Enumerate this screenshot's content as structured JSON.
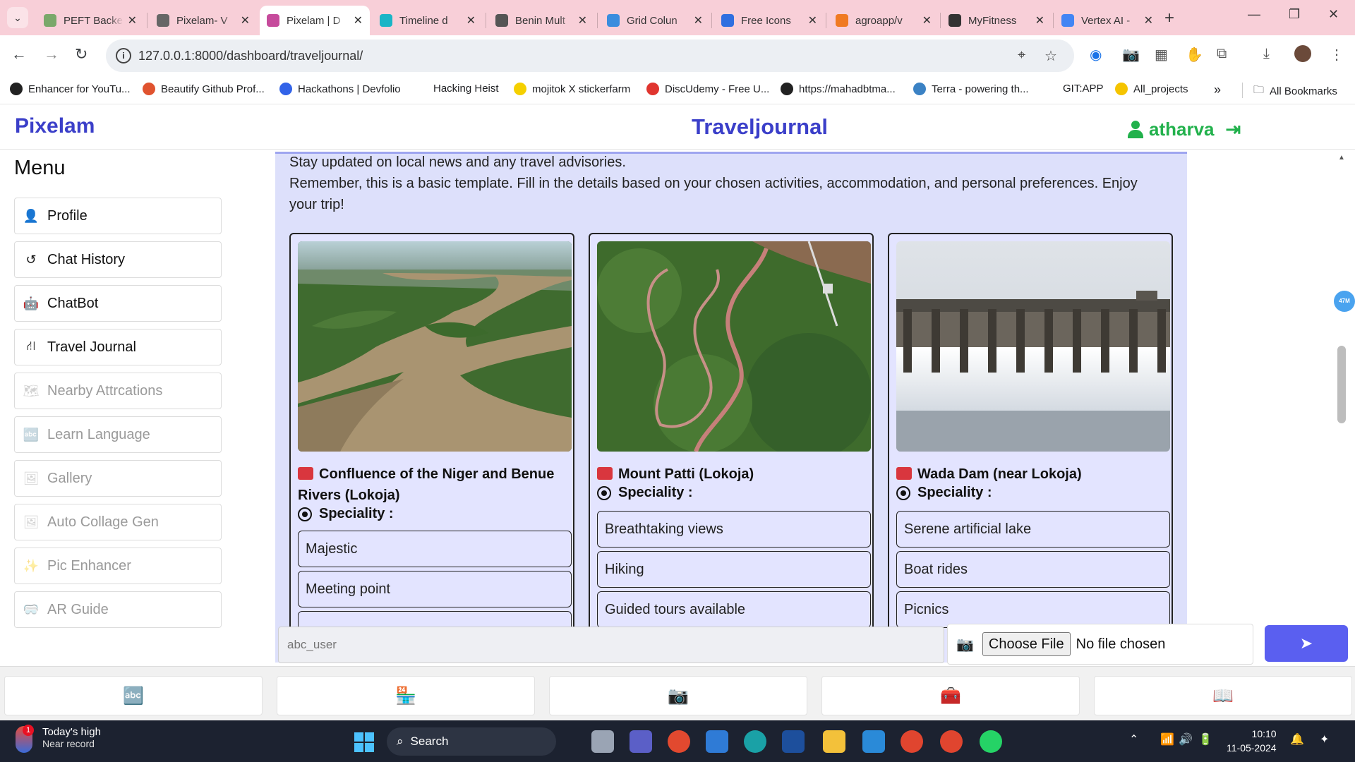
{
  "browser": {
    "tabs": [
      {
        "label": "PEFT Backe",
        "color": "#7aa86a"
      },
      {
        "label": "Pixelam- V",
        "color": "#666666"
      },
      {
        "label": "Pixelam | D",
        "color": "#c64b9c"
      },
      {
        "label": "Timeline d",
        "color": "#19b5c6"
      },
      {
        "label": "Benin Mult",
        "color": "#555555"
      },
      {
        "label": "Grid Colun",
        "color": "#3a8dde"
      },
      {
        "label": "Free Icons",
        "color": "#2f6fe0"
      },
      {
        "label": "agroapp/v",
        "color": "#f07a22"
      },
      {
        "label": "MyFitness",
        "color": "#333333"
      },
      {
        "label": "Vertex AI -",
        "color": "#4285f4"
      }
    ],
    "url": "127.0.0.1:8000/dashboard/traveljournal/",
    "bookmarks": [
      {
        "label": "Enhancer for YouTu...",
        "color": "#222222"
      },
      {
        "label": "Beautify Github Prof...",
        "color": "#e0532f"
      },
      {
        "label": "Hackathons | Devfolio",
        "color": "#3263e8"
      },
      {
        "label": "Hacking Heist",
        "color": ""
      },
      {
        "label": "mojitok X stickerfarm",
        "color": "#f5d000"
      },
      {
        "label": "DiscUdemy - Free U...",
        "color": "#e0352f"
      },
      {
        "label": "https://mahadbtma...",
        "color": "#222222"
      },
      {
        "label": "Terra - powering th...",
        "color": "#3b82c4"
      },
      {
        "label": "GIT:APP",
        "color": ""
      },
      {
        "label": "All_projects",
        "color": "#f5c400"
      }
    ],
    "all_bookmarks": "All Bookmarks"
  },
  "app": {
    "brand": "Pixelam",
    "page_title": "Traveljournal",
    "username": "atharva"
  },
  "sidebar": {
    "title": "Menu",
    "items": [
      {
        "label": "Profile",
        "icon": "user-icon",
        "glyph": "👤",
        "enabled": true
      },
      {
        "label": "Chat History",
        "icon": "history-icon",
        "glyph": "↺",
        "enabled": true
      },
      {
        "label": "ChatBot",
        "icon": "robot-icon",
        "glyph": "🤖",
        "enabled": true
      },
      {
        "label": "Travel Journal",
        "icon": "route-icon",
        "glyph": "⛙",
        "enabled": true
      },
      {
        "label": "Nearby Attrcations",
        "icon": "map-icon",
        "glyph": "🗺",
        "enabled": false
      },
      {
        "label": "Learn Language",
        "icon": "language-icon",
        "glyph": "🔤",
        "enabled": false
      },
      {
        "label": "Gallery",
        "icon": "images-icon",
        "glyph": "🖼",
        "enabled": false
      },
      {
        "label": "Auto Collage Gen",
        "icon": "image-icon",
        "glyph": "🖼",
        "enabled": false
      },
      {
        "label": "Pic Enhancer",
        "icon": "magic-wand-icon",
        "glyph": "✨",
        "enabled": false
      },
      {
        "label": "AR Guide",
        "icon": "vr-headset-icon",
        "glyph": "🥽",
        "enabled": false
      }
    ]
  },
  "content": {
    "intro_line1": "Stay updated on local news and any travel advisories.",
    "intro_line2": "Remember, this is a basic template. Fill in the details based on your chosen activities, accommodation, and personal preferences. Enjoy your trip!",
    "speciality_label": "Speciality :",
    "cards": [
      {
        "name": "Confluence of the Niger and Benue Rivers (Lokoja)",
        "features": [
          "Majestic",
          "Meeting point",
          ""
        ]
      },
      {
        "name": "Mount Patti (Lokoja)",
        "features": [
          "Breathtaking views",
          "Hiking",
          "Guided tours available"
        ]
      },
      {
        "name": "Wada Dam (near Lokoja)",
        "features": [
          "Serene artificial lake",
          "Boat rides",
          "Picnics"
        ]
      }
    ]
  },
  "input_bar": {
    "message_placeholder": "abc_user",
    "choose_file": "Choose File",
    "file_status": "No file chosen"
  },
  "scroll_badge": "47M",
  "bottom_nav": [
    {
      "icon": "language-icon",
      "glyph": "🔤"
    },
    {
      "icon": "store-icon",
      "glyph": "🏪"
    },
    {
      "icon": "camera-icon",
      "glyph": "📷"
    },
    {
      "icon": "medkit-icon",
      "glyph": "🧰"
    },
    {
      "icon": "book-open-icon",
      "glyph": "📖"
    }
  ],
  "taskbar": {
    "weather_title": "Today's high",
    "weather_sub": "Near record",
    "weather_badge": "1",
    "search_label": "Search",
    "time": "10:10",
    "date": "11-05-2024"
  }
}
